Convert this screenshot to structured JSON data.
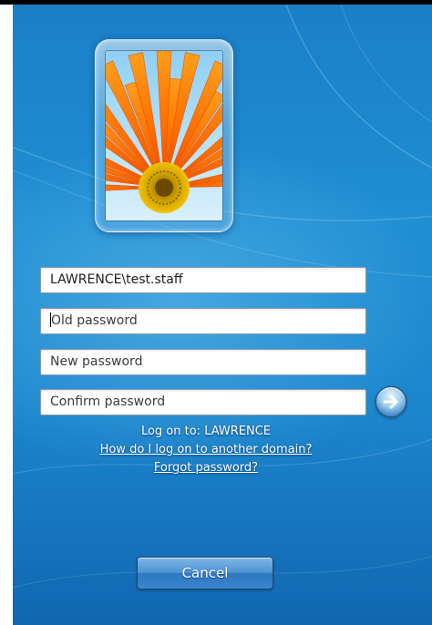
{
  "user_tile": {
    "picture": "orange-gerbera-flower"
  },
  "form": {
    "username": "LAWRENCE\\test.staff",
    "old_password_placeholder": "Old password",
    "new_password_placeholder": "New password",
    "confirm_password_placeholder": "Confirm password"
  },
  "info": {
    "log_on_to": "Log on to: LAWRENCE",
    "other_domain_link": "How do I log on to another domain?",
    "forgot_password_link": "Forgot password?"
  },
  "buttons": {
    "submit_icon": "right-arrow-icon",
    "cancel_label": "Cancel"
  },
  "colors": {
    "background": "#1c86cd",
    "field_border": "#8a9aab",
    "text_on_bg": "#ffffff"
  }
}
